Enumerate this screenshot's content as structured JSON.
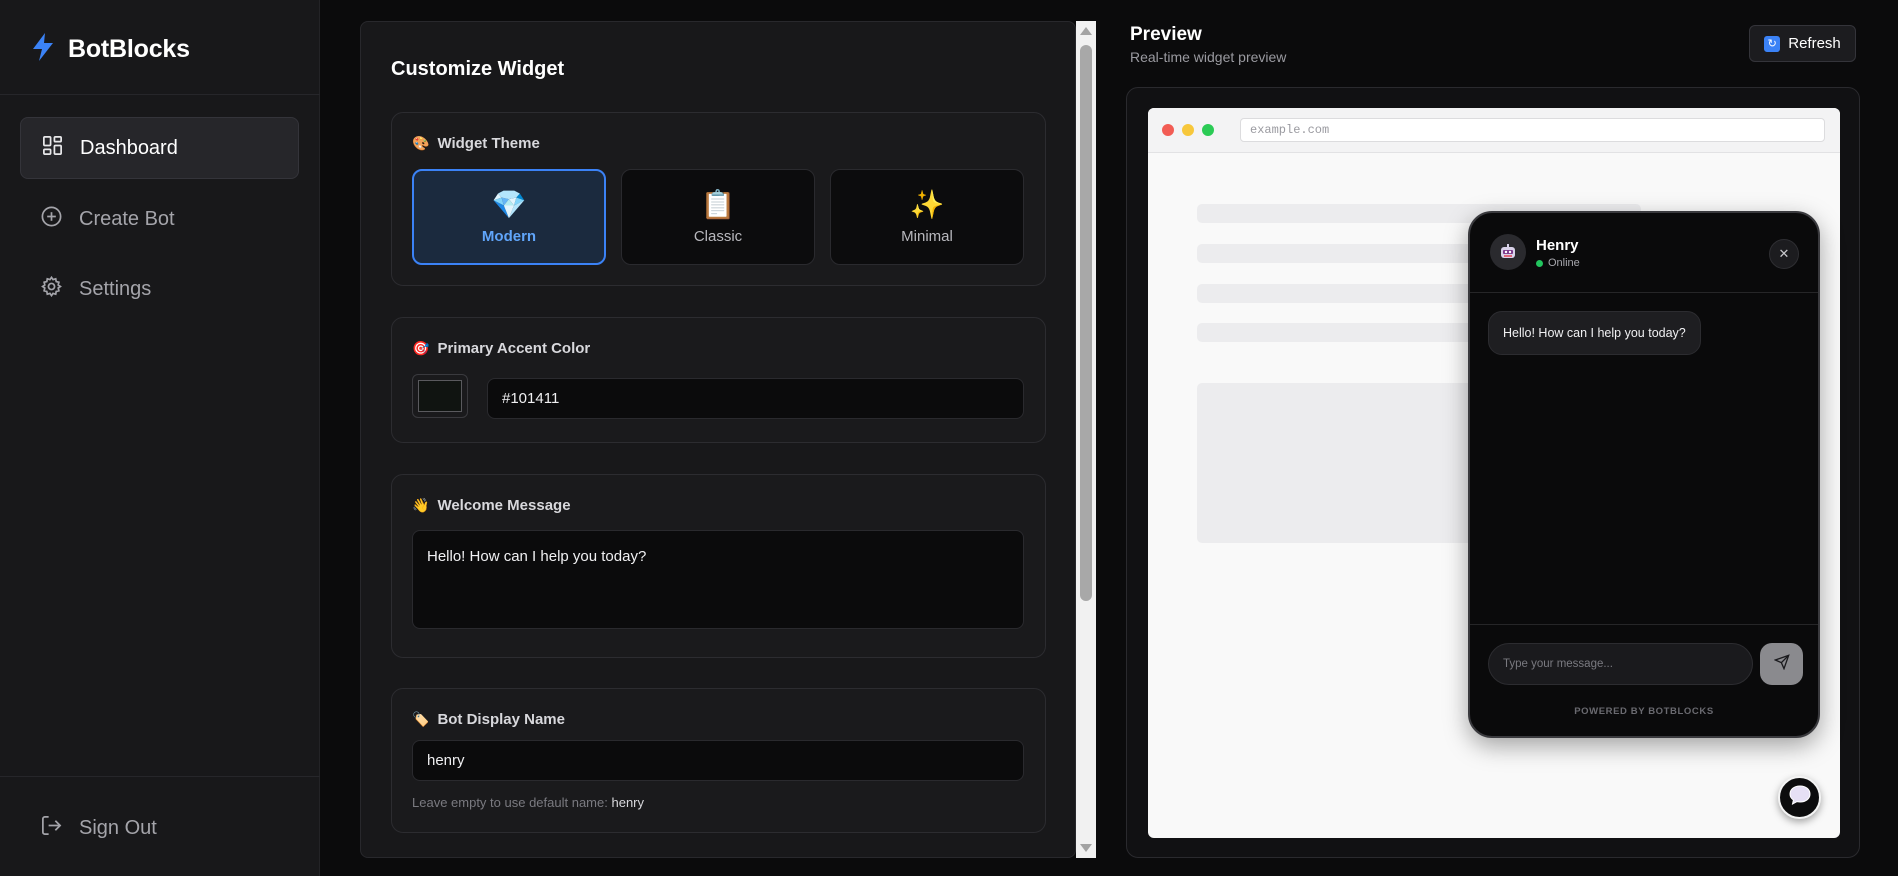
{
  "app": {
    "name": "BotBlocks"
  },
  "sidebar": {
    "items": [
      {
        "label": "Dashboard",
        "icon": "dashboard-icon",
        "active": true
      },
      {
        "label": "Create Bot",
        "icon": "plus-circle-icon",
        "active": false
      },
      {
        "label": "Settings",
        "icon": "gear-icon",
        "active": false
      }
    ],
    "sign_out": "Sign Out"
  },
  "customize": {
    "title": "Customize Widget",
    "theme": {
      "label": "Widget Theme",
      "options": [
        {
          "name": "Modern",
          "icon": "💎",
          "selected": true
        },
        {
          "name": "Classic",
          "icon": "📋",
          "selected": false
        },
        {
          "name": "Minimal",
          "icon": "✨",
          "selected": false
        }
      ]
    },
    "accent": {
      "label": "Primary Accent Color",
      "value": "#101411"
    },
    "welcome": {
      "label": "Welcome Message",
      "value": "Hello! How can I help you today?"
    },
    "display_name": {
      "label": "Bot Display Name",
      "value": "henry",
      "hint": "Leave empty to use default name:",
      "hint_value": "henry"
    }
  },
  "preview": {
    "title": "Preview",
    "subtitle": "Real-time widget preview",
    "refresh_label": "Refresh",
    "url": "example.com",
    "widget": {
      "bot_name": "Henry",
      "status": "Online",
      "greeting": "Hello! How can I help you today?",
      "input_placeholder": "Type your message...",
      "powered_by": "POWERED BY BOTBLOCKS"
    }
  },
  "colors": {
    "brand": "#3b82f6",
    "online": "#22c55e",
    "accent": "#101411"
  }
}
